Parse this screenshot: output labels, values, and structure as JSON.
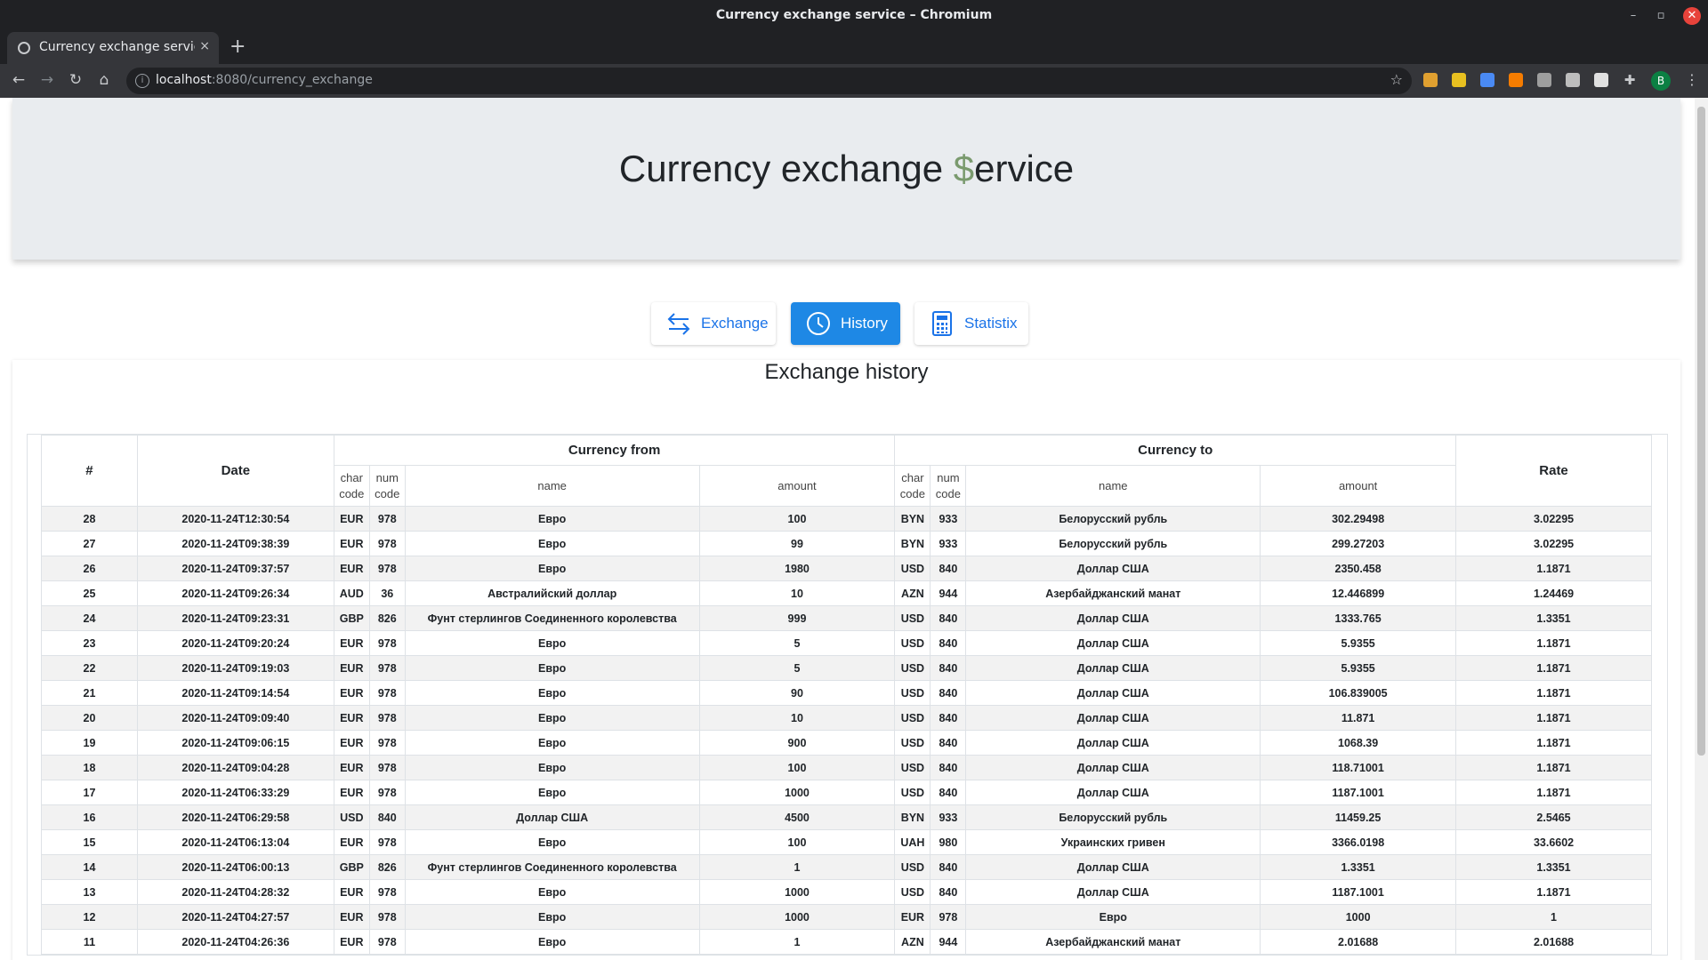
{
  "window": {
    "title": "Currency exchange service – Chromium"
  },
  "tab": {
    "title": "Currency exchange service",
    "close": "×",
    "new_tab": "+"
  },
  "address_bar": {
    "host": "localhost",
    "path": ":8080/currency_exchange"
  },
  "profile": {
    "initial": "B"
  },
  "page": {
    "heading_part1": "Currency exchange ",
    "heading_dollar": "$",
    "heading_part2": "ervice",
    "nav": {
      "exchange": "Exchange",
      "history": "History",
      "statistix": "Statistix"
    },
    "section_title": "Exchange history"
  },
  "table": {
    "headers": {
      "index": "#",
      "date": "Date",
      "currency_from": "Currency from",
      "currency_to": "Currency to",
      "rate": "Rate",
      "char_code": "char code",
      "num_code": "num code",
      "name": "name",
      "amount": "amount"
    },
    "rows": [
      [
        "28",
        "2020-11-24T12:30:54",
        "EUR",
        "978",
        "Евро",
        "100",
        "BYN",
        "933",
        "Белорусский рубль",
        "302.29498",
        "3.02295"
      ],
      [
        "27",
        "2020-11-24T09:38:39",
        "EUR",
        "978",
        "Евро",
        "99",
        "BYN",
        "933",
        "Белорусский рубль",
        "299.27203",
        "3.02295"
      ],
      [
        "26",
        "2020-11-24T09:37:57",
        "EUR",
        "978",
        "Евро",
        "1980",
        "USD",
        "840",
        "Доллар США",
        "2350.458",
        "1.1871"
      ],
      [
        "25",
        "2020-11-24T09:26:34",
        "AUD",
        "36",
        "Австралийский доллар",
        "10",
        "AZN",
        "944",
        "Азербайджанский манат",
        "12.446899",
        "1.24469"
      ],
      [
        "24",
        "2020-11-24T09:23:31",
        "GBP",
        "826",
        "Фунт стерлингов Соединенного королевства",
        "999",
        "USD",
        "840",
        "Доллар США",
        "1333.765",
        "1.3351"
      ],
      [
        "23",
        "2020-11-24T09:20:24",
        "EUR",
        "978",
        "Евро",
        "5",
        "USD",
        "840",
        "Доллар США",
        "5.9355",
        "1.1871"
      ],
      [
        "22",
        "2020-11-24T09:19:03",
        "EUR",
        "978",
        "Евро",
        "5",
        "USD",
        "840",
        "Доллар США",
        "5.9355",
        "1.1871"
      ],
      [
        "21",
        "2020-11-24T09:14:54",
        "EUR",
        "978",
        "Евро",
        "90",
        "USD",
        "840",
        "Доллар США",
        "106.839005",
        "1.1871"
      ],
      [
        "20",
        "2020-11-24T09:09:40",
        "EUR",
        "978",
        "Евро",
        "10",
        "USD",
        "840",
        "Доллар США",
        "11.871",
        "1.1871"
      ],
      [
        "19",
        "2020-11-24T09:06:15",
        "EUR",
        "978",
        "Евро",
        "900",
        "USD",
        "840",
        "Доллар США",
        "1068.39",
        "1.1871"
      ],
      [
        "18",
        "2020-11-24T09:04:28",
        "EUR",
        "978",
        "Евро",
        "100",
        "USD",
        "840",
        "Доллар США",
        "118.71001",
        "1.1871"
      ],
      [
        "17",
        "2020-11-24T06:33:29",
        "EUR",
        "978",
        "Евро",
        "1000",
        "USD",
        "840",
        "Доллар США",
        "1187.1001",
        "1.1871"
      ],
      [
        "16",
        "2020-11-24T06:29:58",
        "USD",
        "840",
        "Доллар США",
        "4500",
        "BYN",
        "933",
        "Белорусский рубль",
        "11459.25",
        "2.5465"
      ],
      [
        "15",
        "2020-11-24T06:13:04",
        "EUR",
        "978",
        "Евро",
        "100",
        "UAH",
        "980",
        "Украинских гривен",
        "3366.0198",
        "33.6602"
      ],
      [
        "14",
        "2020-11-24T06:00:13",
        "GBP",
        "826",
        "Фунт стерлингов Соединенного королевства",
        "1",
        "USD",
        "840",
        "Доллар США",
        "1.3351",
        "1.3351"
      ],
      [
        "13",
        "2020-11-24T04:28:32",
        "EUR",
        "978",
        "Евро",
        "1000",
        "USD",
        "840",
        "Доллар США",
        "1187.1001",
        "1.1871"
      ],
      [
        "12",
        "2020-11-24T04:27:57",
        "EUR",
        "978",
        "Евро",
        "1000",
        "EUR",
        "978",
        "Евро",
        "1000",
        "1"
      ],
      [
        "11",
        "2020-11-24T04:26:36",
        "EUR",
        "978",
        "Евро",
        "1",
        "AZN",
        "944",
        "Азербайджанский манат",
        "2.01688",
        "2.01688"
      ]
    ]
  }
}
